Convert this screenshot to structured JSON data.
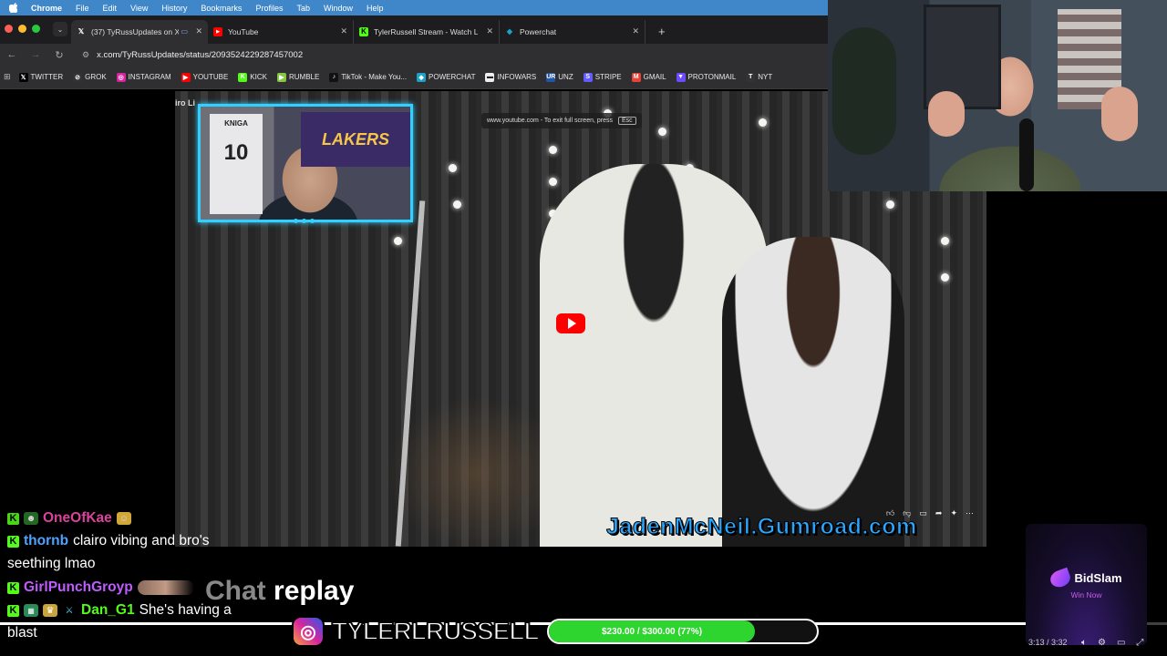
{
  "menubar": {
    "apple_icon": "apple-icon",
    "app": "Chrome",
    "items": [
      "File",
      "Edit",
      "View",
      "History",
      "Bookmarks",
      "Profiles",
      "Tab",
      "Window",
      "Help"
    ]
  },
  "tabs": [
    {
      "title": "(37) TyRussUpdates on X",
      "icon": "x-logo-icon",
      "active": true
    },
    {
      "title": "YouTube",
      "icon": "youtube-icon",
      "active": false
    },
    {
      "title": "TylerRussell Stream - Watch L",
      "icon": "kick-icon",
      "active": false
    },
    {
      "title": "Powerchat",
      "icon": "powerchat-icon",
      "active": false
    }
  ],
  "address": {
    "url": "x.com/TyRussUpdates/status/2093524229287457002"
  },
  "bookmarks": [
    {
      "label": "TWITTER",
      "icon": "x-logo-icon",
      "color": "#000000",
      "glyph": "𝕏"
    },
    {
      "label": "GROK",
      "icon": "grok-icon",
      "color": "#333333",
      "glyph": "⊘"
    },
    {
      "label": "INSTAGRAM",
      "icon": "instagram-icon",
      "color": "#d6249f",
      "glyph": "◎"
    },
    {
      "label": "YOUTUBE",
      "icon": "youtube-icon",
      "color": "#ff0000",
      "glyph": "▶"
    },
    {
      "label": "KICK",
      "icon": "kick-icon",
      "color": "#53fc18",
      "glyph": "K"
    },
    {
      "label": "RUMBLE",
      "icon": "rumble-icon",
      "color": "#85c742",
      "glyph": "▶"
    },
    {
      "label": "TikTok - Make You...",
      "icon": "tiktok-icon",
      "color": "#111111",
      "glyph": "♪"
    },
    {
      "label": "POWERCHAT",
      "icon": "powerchat-icon",
      "color": "#1aa3c8",
      "glyph": "◆"
    },
    {
      "label": "INFOWARS",
      "icon": "infowars-icon",
      "color": "#eeeeee",
      "glyph": "▬"
    },
    {
      "label": "UNZ",
      "icon": "unz-icon",
      "color": "#2255aa",
      "glyph": "UR"
    },
    {
      "label": "STRIPE",
      "icon": "stripe-icon",
      "color": "#635bff",
      "glyph": "S"
    },
    {
      "label": "GMAIL",
      "icon": "gmail-icon",
      "color": "#ea4335",
      "glyph": "M"
    },
    {
      "label": "PROTONMAIL",
      "icon": "protonmail-icon",
      "color": "#6d4aff",
      "glyph": "▼"
    },
    {
      "label": "NYT",
      "icon": "nyt-icon",
      "color": "#333333",
      "glyph": "T"
    }
  ],
  "video": {
    "corner_label": "iro Li",
    "fullscreen_notice": "www.youtube.com - To exit full screen, press",
    "fullscreen_key": "Esc",
    "watermark": "JadenMcNeil.Gumroad.com",
    "jersey_name": "KNIGA",
    "jersey_number": "10",
    "cap_text": "LAKERS"
  },
  "chat": {
    "messages": [
      {
        "user": "OneOfKae",
        "text": "",
        "color": "#ff4fb8"
      },
      {
        "user": "thornb",
        "text": "clairo vibing and bro's",
        "color": "#4fa3ff"
      },
      {
        "user": "",
        "text": "seething lmao",
        "color": "#ffffff"
      },
      {
        "user": "GirlPunchGroyp",
        "text": "",
        "color": "#c05cff"
      },
      {
        "user": "Dan_G1",
        "text": "She's having a",
        "color": "#53fc18"
      },
      {
        "user": "",
        "text": "blast",
        "color": "#ffffff"
      }
    ],
    "replay_label_faded": "Chat",
    "replay_label": "replay"
  },
  "overlays": {
    "instagram_handle": "TYLERLRUSSELL",
    "goal_text": "$230.00 / $300.00 (77%)",
    "goal_fraction": 0.77,
    "sponsor_name": "BidSlam",
    "sponsor_cta": "Win Now",
    "player_progress": 0.98,
    "time_display": "3:13 / 3:32"
  }
}
